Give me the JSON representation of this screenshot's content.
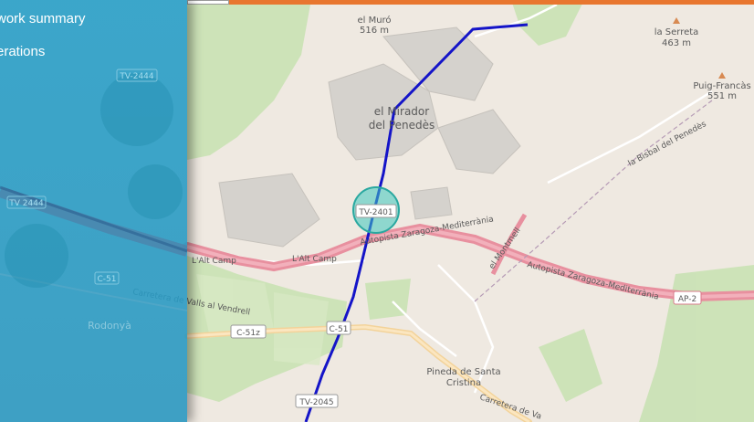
{
  "sidebar": {
    "items": [
      {
        "label": "work summary"
      },
      {
        "label": "erations"
      }
    ]
  },
  "map": {
    "peaks": [
      {
        "name": "el Muró",
        "elevation": "516 m"
      },
      {
        "name": "la Serreta",
        "elevation": "463 m"
      },
      {
        "name": "Puig-Francàs",
        "elevation": "551 m"
      }
    ],
    "places": {
      "mirador": [
        "el Mirador",
        "del Penedès"
      ],
      "rodonya": "Rodonyà",
      "pineda": [
        "Pineda de Santa",
        "Cristina"
      ],
      "bisbal": "la Bisbal del Penedès",
      "montmell": "el Montmell"
    },
    "roads": {
      "tv2444_a": "TV-2444",
      "tv2444_b": "TV 2444",
      "c51": "C-51",
      "c51z": "C-51z",
      "c51b": "C-51",
      "tv2401": "TV-2401",
      "tv2045": "TV-2045",
      "ap2": "AP-2",
      "autopista_a": "Autopista Zaragoza-Mediterrània",
      "autopista_b": "Autopista Zaragoza-Mediterrània",
      "altcamp_a": "L'Alt Camp",
      "altcamp_b": "L'Alt Camp",
      "carretera_valls": "Carretera de Valls al Vendrell",
      "carretera_valls_b": "Carretera de Va"
    },
    "colors": {
      "route": "#1414c8",
      "motorway": "#e8909f",
      "accent_bar": "#e8762f",
      "marker": "#3ec8c0",
      "sidebar": "#2ca0c8"
    }
  }
}
